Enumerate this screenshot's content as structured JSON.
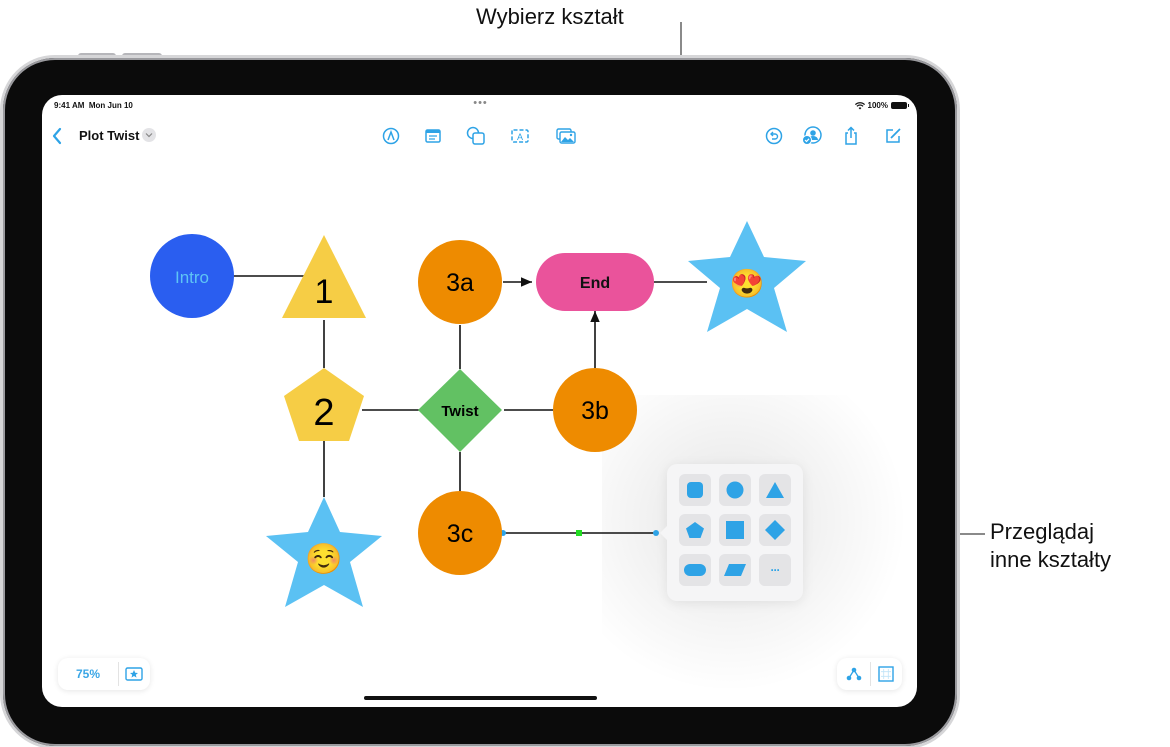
{
  "callouts": {
    "choose_shape": "Wybierz kształt",
    "browse_line1": "Przeglądaj",
    "browse_line2": "inne kształty"
  },
  "status_bar": {
    "time": "9:41 AM",
    "date": "Mon Jun 10",
    "battery": "100%",
    "more_indicator": "•••"
  },
  "toolbar": {
    "back_icon": "chevron-left-icon",
    "title": "Plot Twist",
    "title_menu_icon": "chevron-down-icon",
    "center_tools": [
      {
        "name": "pen-tool-icon"
      },
      {
        "name": "sticky-note-icon"
      },
      {
        "name": "shapes-icon"
      },
      {
        "name": "text-box-icon"
      },
      {
        "name": "media-icon"
      }
    ],
    "right_tools": [
      {
        "name": "undo-history-icon"
      },
      {
        "name": "collaborate-icon"
      },
      {
        "name": "share-icon"
      },
      {
        "name": "compose-icon"
      }
    ]
  },
  "canvas": {
    "nodes": [
      {
        "id": "intro",
        "label": "Intro",
        "shape": "circle",
        "fill": "#2a5ef0",
        "text_color": "#5ec4f5"
      },
      {
        "id": "n1",
        "label": "1",
        "shape": "triangle",
        "fill": "#f6cd45",
        "text_color": "#000000"
      },
      {
        "id": "n2",
        "label": "2",
        "shape": "pentagon",
        "fill": "#f6cd45",
        "text_color": "#000000"
      },
      {
        "id": "star1",
        "label": "☺️",
        "shape": "star",
        "fill": "#5bc1f3"
      },
      {
        "id": "n3a",
        "label": "3a",
        "shape": "circle",
        "fill": "#ee8b00",
        "text_color": "#000000"
      },
      {
        "id": "twist",
        "label": "Twist",
        "shape": "diamond",
        "fill": "#62c163",
        "text_color": "#000000"
      },
      {
        "id": "n3b",
        "label": "3b",
        "shape": "circle",
        "fill": "#ee8b00",
        "text_color": "#000000"
      },
      {
        "id": "n3c",
        "label": "3c",
        "shape": "circle",
        "fill": "#ee8b00",
        "text_color": "#000000"
      },
      {
        "id": "end",
        "label": "End",
        "shape": "pill",
        "fill": "#ea539b",
        "text_color": "#000000"
      },
      {
        "id": "star2",
        "label": "😍",
        "shape": "star",
        "fill": "#5bc1f3"
      }
    ]
  },
  "shape_picker": {
    "shapes": [
      {
        "name": "rounded-square-shape"
      },
      {
        "name": "circle-shape"
      },
      {
        "name": "triangle-shape"
      },
      {
        "name": "pentagon-shape"
      },
      {
        "name": "square-shape"
      },
      {
        "name": "diamond-shape"
      },
      {
        "name": "pill-shape"
      },
      {
        "name": "parallelogram-shape"
      },
      {
        "name": "more-shapes",
        "label": "···"
      }
    ],
    "accent": "#2ea3e6"
  },
  "bottom_controls": {
    "zoom_level": "75%",
    "favorites_icon": "star-board-icon",
    "connector_icon": "connection-style-icon",
    "grid_icon": "grid-icon"
  }
}
